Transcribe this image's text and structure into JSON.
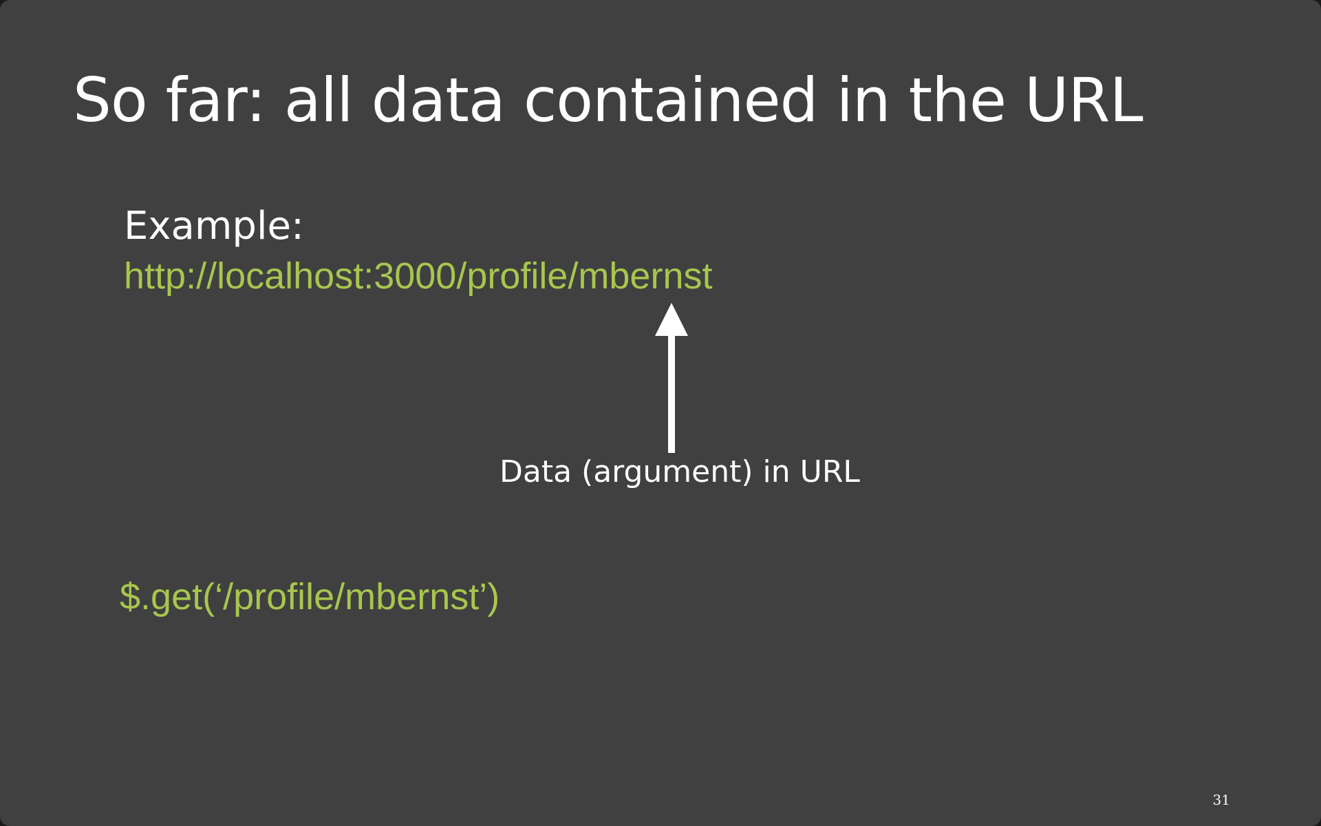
{
  "slide": {
    "title": "So far: all data contained in the URL",
    "example_label": "Example:",
    "example_url": "http://localhost:3000/profile/mbernst",
    "arrow_label": "Data (argument) in URL",
    "code_call": "$.get(‘/profile/mbernst’)",
    "page_number": "31"
  },
  "colors": {
    "background": "#404040",
    "text": "#ffffff",
    "code": "#a8c64e"
  },
  "icons": {
    "arrow": "arrow-up-icon"
  }
}
